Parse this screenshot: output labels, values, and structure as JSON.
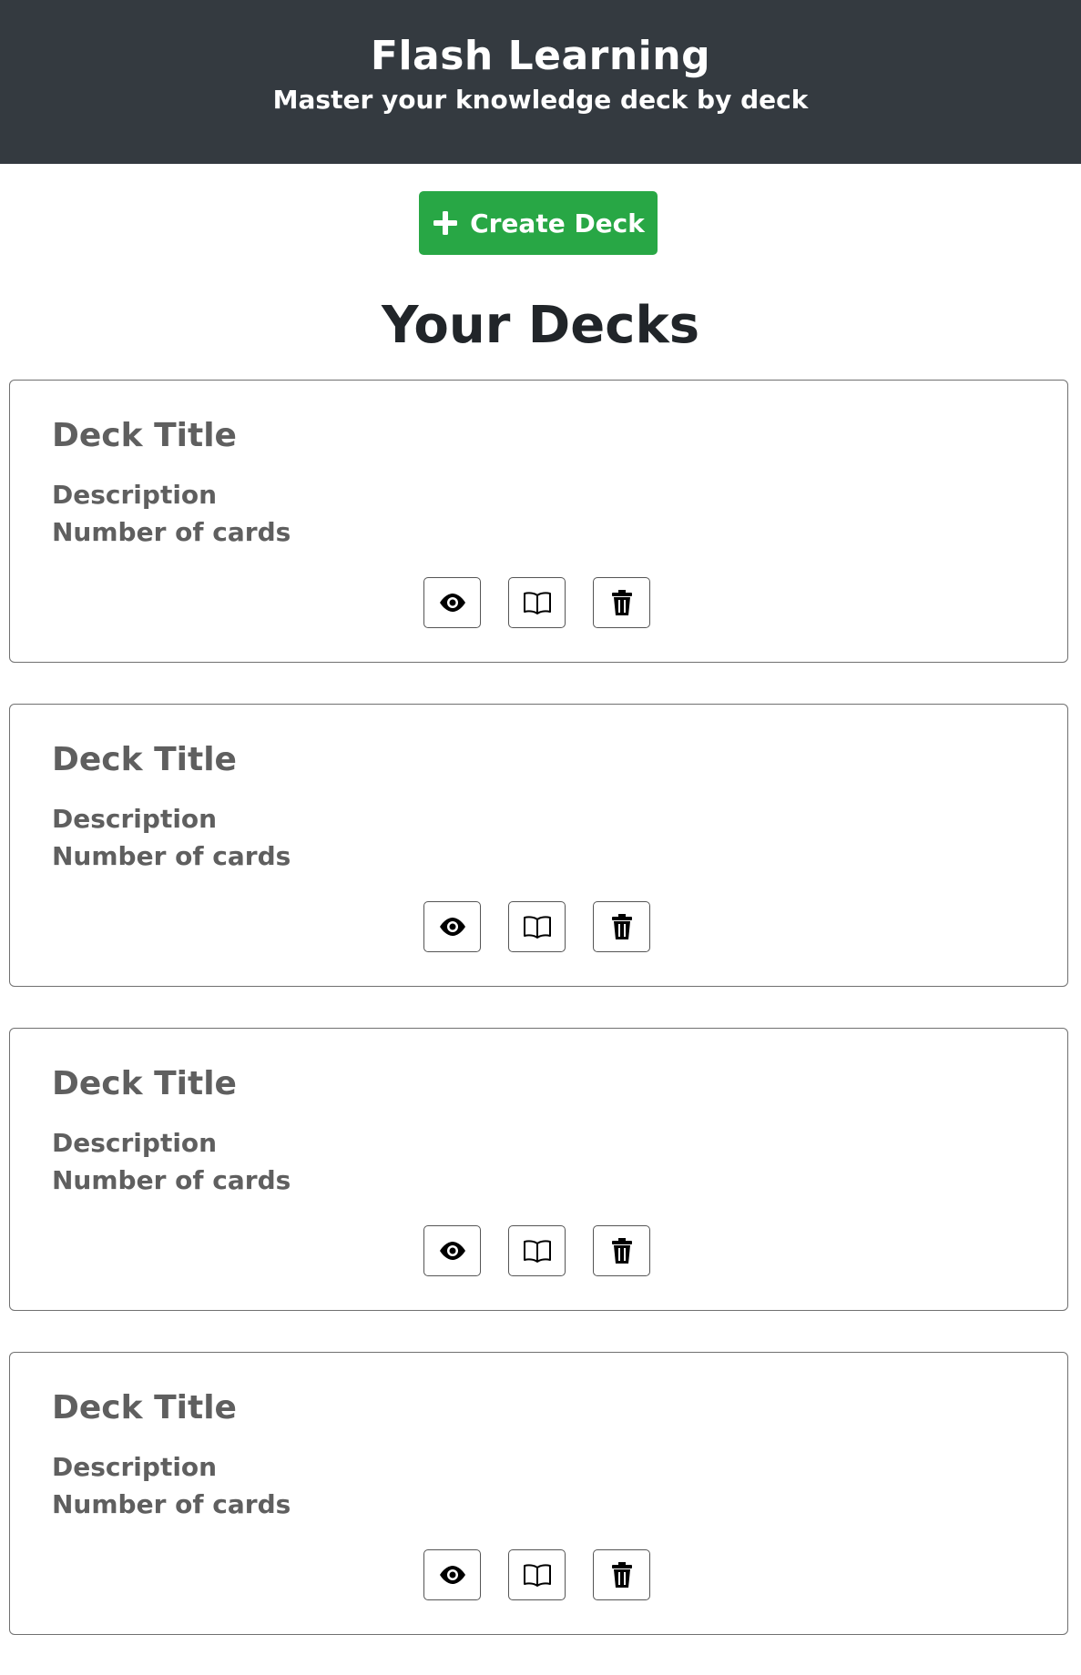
{
  "header": {
    "title": "Flash Learning",
    "subtitle": "Master your knowledge deck by deck"
  },
  "actions": {
    "create_label": "Create Deck",
    "create_icon": "plus-icon"
  },
  "decks_section": {
    "title": "Your Decks"
  },
  "decks": [
    {
      "title": "Deck Title",
      "description": "Description",
      "count": "Number of cards",
      "buttons": [
        "eye-icon",
        "book-icon",
        "trash-icon"
      ]
    },
    {
      "title": "Deck Title",
      "description": "Description",
      "count": "Number of cards",
      "buttons": [
        "eye-icon",
        "book-icon",
        "trash-icon"
      ]
    },
    {
      "title": "Deck Title",
      "description": "Description",
      "count": "Number of cards",
      "buttons": [
        "eye-icon",
        "book-icon",
        "trash-icon"
      ]
    },
    {
      "title": "Deck Title",
      "description": "Description",
      "count": "Number of cards",
      "buttons": [
        "eye-icon",
        "book-icon",
        "trash-icon"
      ]
    }
  ],
  "colors": {
    "header_bg": "#343a40",
    "primary_green": "#28a745",
    "deck_text": "#5f5f5f"
  }
}
